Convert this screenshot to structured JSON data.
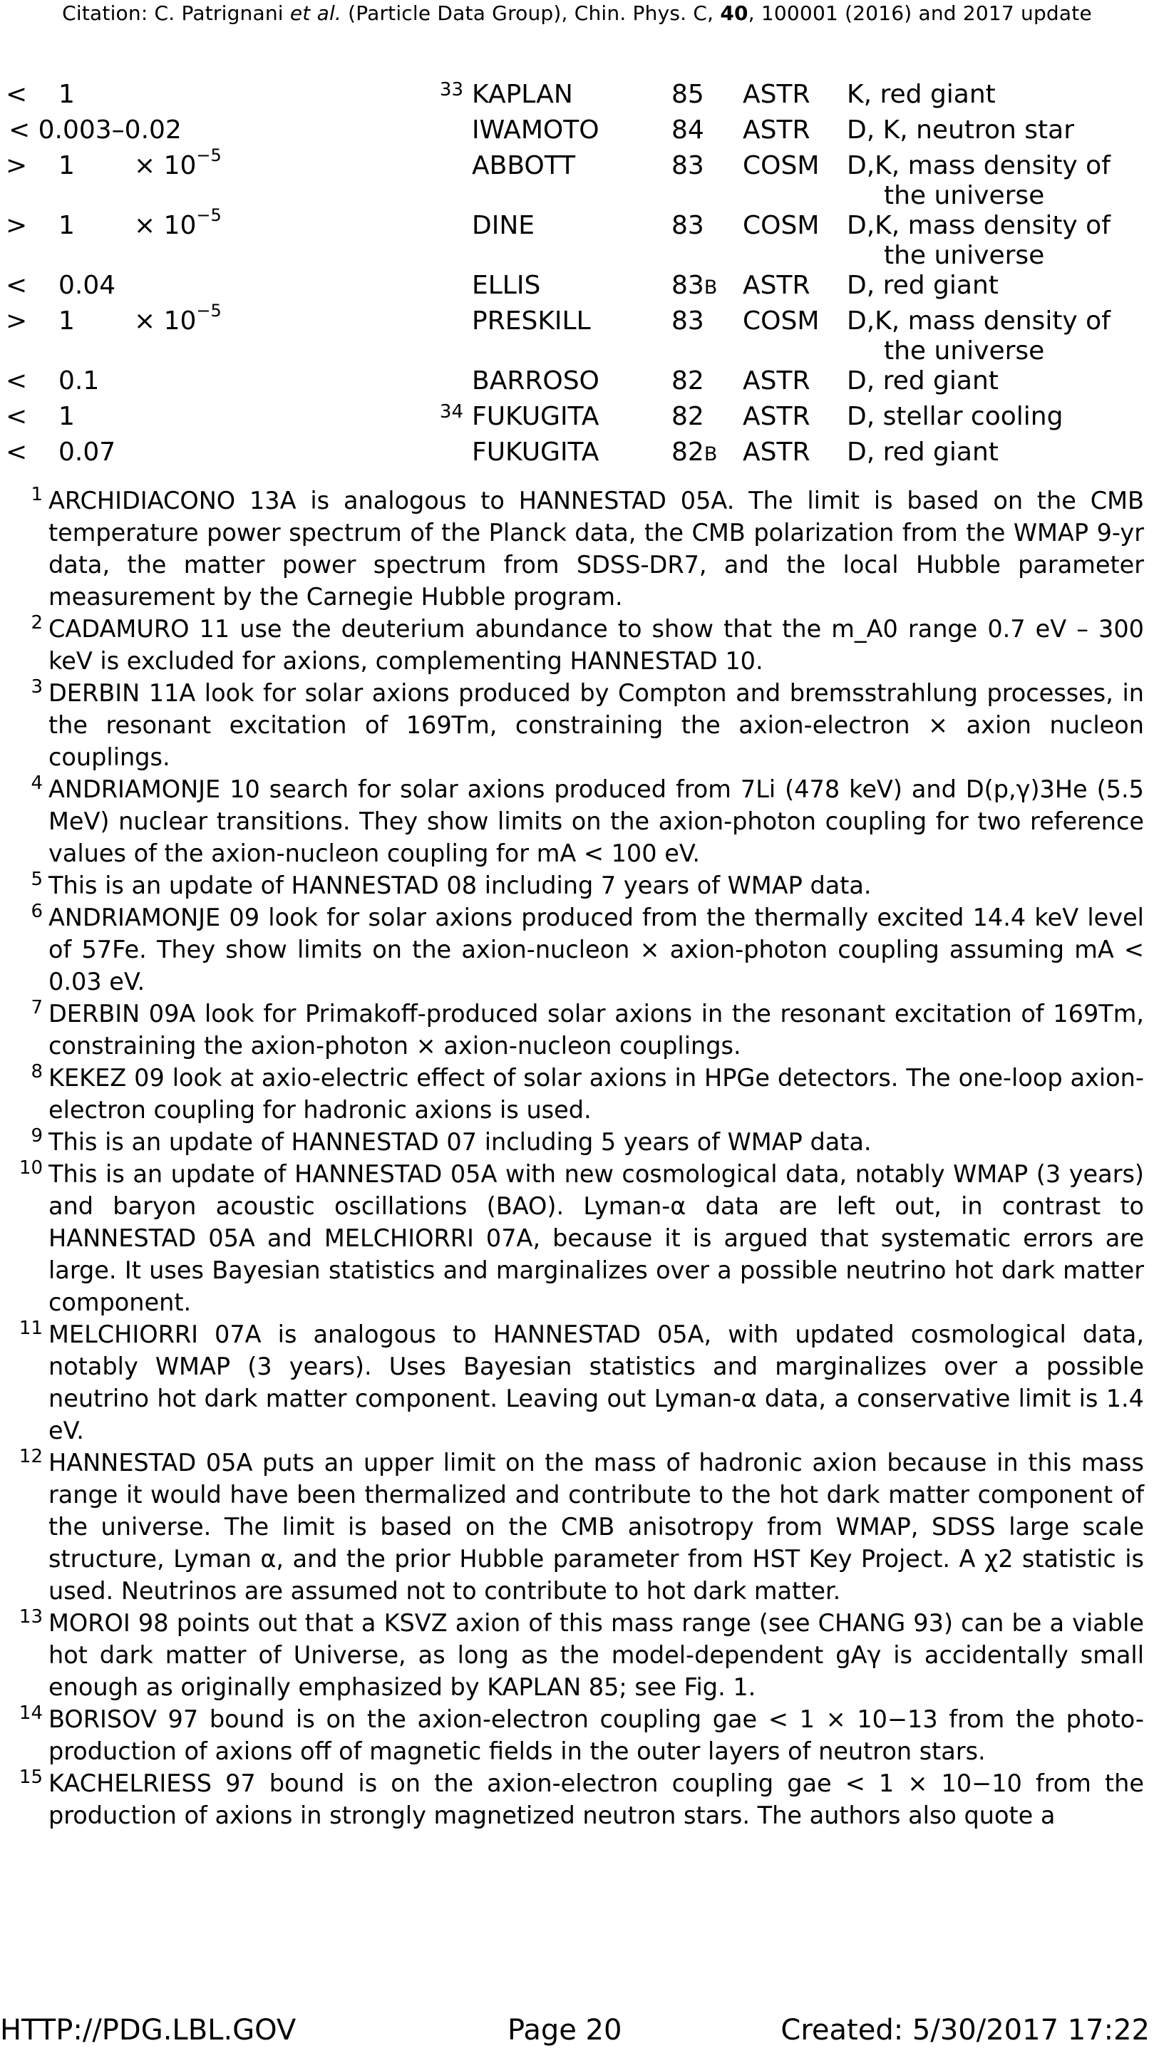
{
  "header": {
    "citation_prefix": "Citation: C. Patrignani ",
    "citation_etal": "et al.",
    "citation_mid": " (Particle Data Group), Chin. Phys. C, ",
    "citation_vol": "40",
    "citation_suffix": ", 100001 (2016) and 2017 update"
  },
  "table_rows": [
    {
      "rel": "<",
      "val": "1",
      "exp": "",
      "note": "33",
      "doc": "KAPLAN",
      "yr": "85",
      "yr_sfx": "",
      "tec": "ASTR",
      "com": "K, red giant",
      "com2": ""
    },
    {
      "rel": "",
      "val": "< 0.003–0.02",
      "exp": "",
      "note": "",
      "doc": "IWAMOTO",
      "yr": "84",
      "yr_sfx": "",
      "tec": "ASTR",
      "com": "D, K, neutron star",
      "com2": ""
    },
    {
      "rel": ">",
      "val": "1",
      "exp": "× 10−5",
      "note": "",
      "doc": "ABBOTT",
      "yr": "83",
      "yr_sfx": "",
      "tec": "COSM",
      "com": "D,K, mass density of",
      "com2": "the universe"
    },
    {
      "rel": ">",
      "val": "1",
      "exp": "× 10−5",
      "note": "",
      "doc": "DINE",
      "yr": "83",
      "yr_sfx": "",
      "tec": "COSM",
      "com": "D,K, mass density of",
      "com2": "the universe"
    },
    {
      "rel": "<",
      "val": "0.04",
      "exp": "",
      "note": "",
      "doc": "ELLIS",
      "yr": "83",
      "yr_sfx": "B",
      "tec": "ASTR",
      "com": "D, red giant",
      "com2": ""
    },
    {
      "rel": ">",
      "val": "1",
      "exp": "× 10−5",
      "note": "",
      "doc": "PRESKILL",
      "yr": "83",
      "yr_sfx": "",
      "tec": "COSM",
      "com": "D,K, mass density of",
      "com2": "the universe"
    },
    {
      "rel": "<",
      "val": "0.1",
      "exp": "",
      "note": "",
      "doc": "BARROSO",
      "yr": "82",
      "yr_sfx": "",
      "tec": "ASTR",
      "com": "D, red giant",
      "com2": ""
    },
    {
      "rel": "<",
      "val": "1",
      "exp": "",
      "note": "34",
      "doc": "FUKUGITA",
      "yr": "82",
      "yr_sfx": "",
      "tec": "ASTR",
      "com": "D, stellar cooling",
      "com2": ""
    },
    {
      "rel": "<",
      "val": "0.07",
      "exp": "",
      "note": "",
      "doc": "FUKUGITA",
      "yr": "82",
      "yr_sfx": "B",
      "tec": "ASTR",
      "com": "D, red giant",
      "com2": ""
    }
  ],
  "footnotes": [
    {
      "num": "1",
      "text": "ARCHIDIACONO 13A is analogous to HANNESTAD 05A. The limit is based on the CMB temperature power spectrum of the Planck data, the CMB polarization from the WMAP 9-yr data, the matter power spectrum from SDSS-DR7, and the local Hubble parameter measurement by the Carnegie Hubble program."
    },
    {
      "num": "2",
      "text": "CADAMURO 11 use the deuterium abundance to show that the m_A0 range 0.7 eV – 300 keV is excluded for axions, complementing HANNESTAD 10."
    },
    {
      "num": "3",
      "text": "DERBIN 11A look for solar axions produced by Compton and bremsstrahlung processes, in the resonant excitation of 169Tm, constraining the axion-electron × axion nucleon couplings."
    },
    {
      "num": "4",
      "text": "ANDRIAMONJE 10 search for solar axions produced from 7Li (478 keV) and D(p,γ)3He (5.5 MeV) nuclear transitions. They show limits on the axion-photon coupling for two reference values of the axion-nucleon coupling for mA < 100 eV."
    },
    {
      "num": "5",
      "text": "This is an update of HANNESTAD 08 including 7 years of WMAP data."
    },
    {
      "num": "6",
      "text": "ANDRIAMONJE 09 look for solar axions produced from the thermally excited 14.4 keV level of 57Fe. They show limits on the axion-nucleon × axion-photon coupling assuming mA < 0.03 eV."
    },
    {
      "num": "7",
      "text": "DERBIN 09A look for Primakoff-produced solar axions in the resonant excitation of 169Tm, constraining the axion-photon × axion-nucleon couplings."
    },
    {
      "num": "8",
      "text": "KEKEZ 09 look at axio-electric effect of solar axions in HPGe detectors. The one-loop axion-electron coupling for hadronic axions is used."
    },
    {
      "num": "9",
      "text": "This is an update of HANNESTAD 07 including 5 years of WMAP data."
    },
    {
      "num": "10",
      "text": "This is an update of HANNESTAD 05A with new cosmological data, notably WMAP (3 years) and baryon acoustic oscillations (BAO). Lyman-α data are left out, in contrast to HANNESTAD 05A and MELCHIORRI 07A, because it is argued that systematic errors are large. It uses Bayesian statistics and marginalizes over a possible neutrino hot dark matter component."
    },
    {
      "num": "11",
      "text": "MELCHIORRI 07A is analogous to HANNESTAD 05A, with updated cosmological data, notably WMAP (3 years). Uses Bayesian statistics and marginalizes over a possible neutrino hot dark matter component. Leaving out Lyman-α data, a conservative limit is 1.4 eV."
    },
    {
      "num": "12",
      "text": "HANNESTAD 05A puts an upper limit on the mass of hadronic axion because in this mass range it would have been thermalized and contribute to the hot dark matter component of the universe. The limit is based on the CMB anisotropy from WMAP, SDSS large scale structure, Lyman α, and the prior Hubble parameter from HST Key Project. A χ2 statistic is used. Neutrinos are assumed not to contribute to hot dark matter."
    },
    {
      "num": "13",
      "text": "MOROI 98 points out that a KSVZ axion of this mass range (see CHANG 93) can be a viable hot dark matter of Universe, as long as the model-dependent gAγ is accidentally small enough as originally emphasized by KAPLAN 85; see Fig. 1."
    },
    {
      "num": "14",
      "text": "BORISOV 97 bound is on the axion-electron coupling gae < 1 × 10−13 from the photo-production of axions off of magnetic fields in the outer layers of neutron stars."
    },
    {
      "num": "15",
      "text": "KACHELRIESS 97 bound is on the axion-electron coupling gae < 1 × 10−10 from the production of axions in strongly magnetized neutron stars. The authors also quote a"
    }
  ],
  "footer": {
    "url": "HTTP://PDG.LBL.GOV",
    "page": "Page 20",
    "created": "Created: 5/30/2017 17:22"
  }
}
